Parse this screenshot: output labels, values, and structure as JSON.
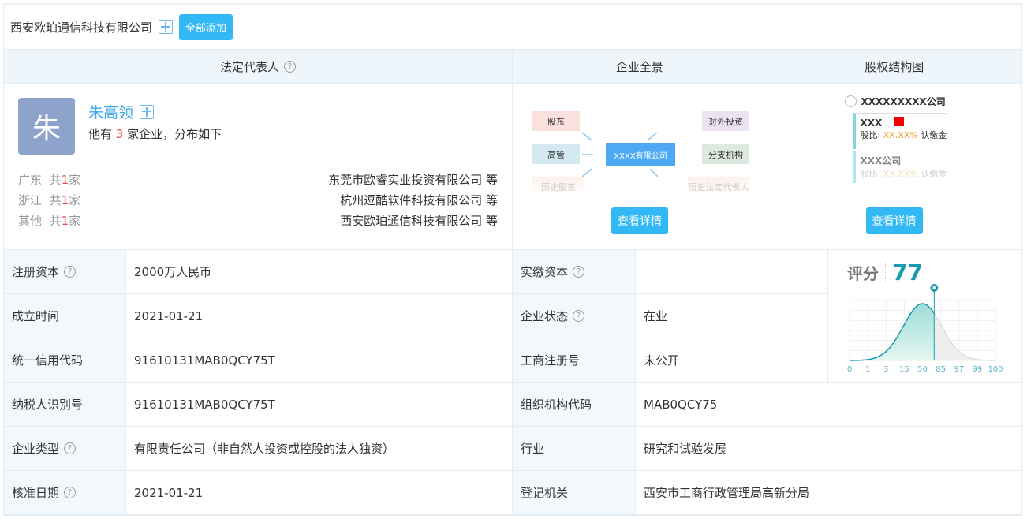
{
  "company": {
    "name": "西安欧珀通信科技有限公司",
    "add_all": "全部添加"
  },
  "headers": {
    "legal_rep": "法定代表人",
    "panorama": "企业全景",
    "equity": "股权结构图",
    "help": "?"
  },
  "legal": {
    "avatar_char": "朱",
    "name": "朱高领",
    "summary_prefix": "他有",
    "count": "3",
    "summary_suffix": "家企业，分布如下",
    "regions": [
      {
        "region": "广东",
        "pre": "共",
        "n": "1",
        "post": "家",
        "company": "东莞市欧睿实业投资有限公司 等"
      },
      {
        "region": "浙江",
        "pre": "共",
        "n": "1",
        "post": "家",
        "company": "杭州逗酷软件科技有限公司 等"
      },
      {
        "region": "其他",
        "pre": "共",
        "n": "1",
        "post": "家",
        "company": "西安欧珀通信科技有限公司 等"
      }
    ]
  },
  "panorama": {
    "nodes": {
      "shareholder": "股东",
      "exec": "高管",
      "hist_sh": "历史股东",
      "center": "XXXX有限公司",
      "invest": "对外投资",
      "branch": "分支机构",
      "hist_rep": "历史法定代表人"
    },
    "detail": "查看详情"
  },
  "equity": {
    "root": "XXXXXXXXX公司",
    "p1": "XXX",
    "ratio_label": "股比:",
    "ratio": "XX.XX%",
    "sub": "认缴金",
    "p2": "XXX公司",
    "detail": "查看详情"
  },
  "rows": [
    {
      "l1": "注册资本",
      "h1": true,
      "v1": "2000万人民币",
      "l2": "实缴资本",
      "h2": true,
      "v2": ""
    },
    {
      "l1": "成立时间",
      "v1": "2021-01-21",
      "l2": "企业状态",
      "h2": true,
      "v2": "在业"
    },
    {
      "l1": "统一信用代码",
      "v1": "91610131MAB0QCY75T",
      "l2": "工商注册号",
      "v2": "未公开"
    },
    {
      "l1": "纳税人识别号",
      "v1": "91610131MAB0QCY75T",
      "l2": "组织机构代码",
      "v2": "MAB0QCY75"
    },
    {
      "l1": "企业类型",
      "h1": true,
      "v1": "有限责任公司（非自然人投资或控股的法人独资）",
      "l2": "行业",
      "v2": "研究和试验发展"
    },
    {
      "l1": "核准日期",
      "h1": true,
      "v1": "2021-01-21",
      "l2": "登记机关",
      "v2": "西安市工商行政管理局高新分局"
    }
  ],
  "score": {
    "label": "评分",
    "value": "77",
    "ticks": [
      "0",
      "1",
      "3",
      "15",
      "50",
      "85",
      "97",
      "99",
      "100"
    ],
    "marker_tick_fraction": 0.58,
    "color": "#1a9bb0"
  }
}
